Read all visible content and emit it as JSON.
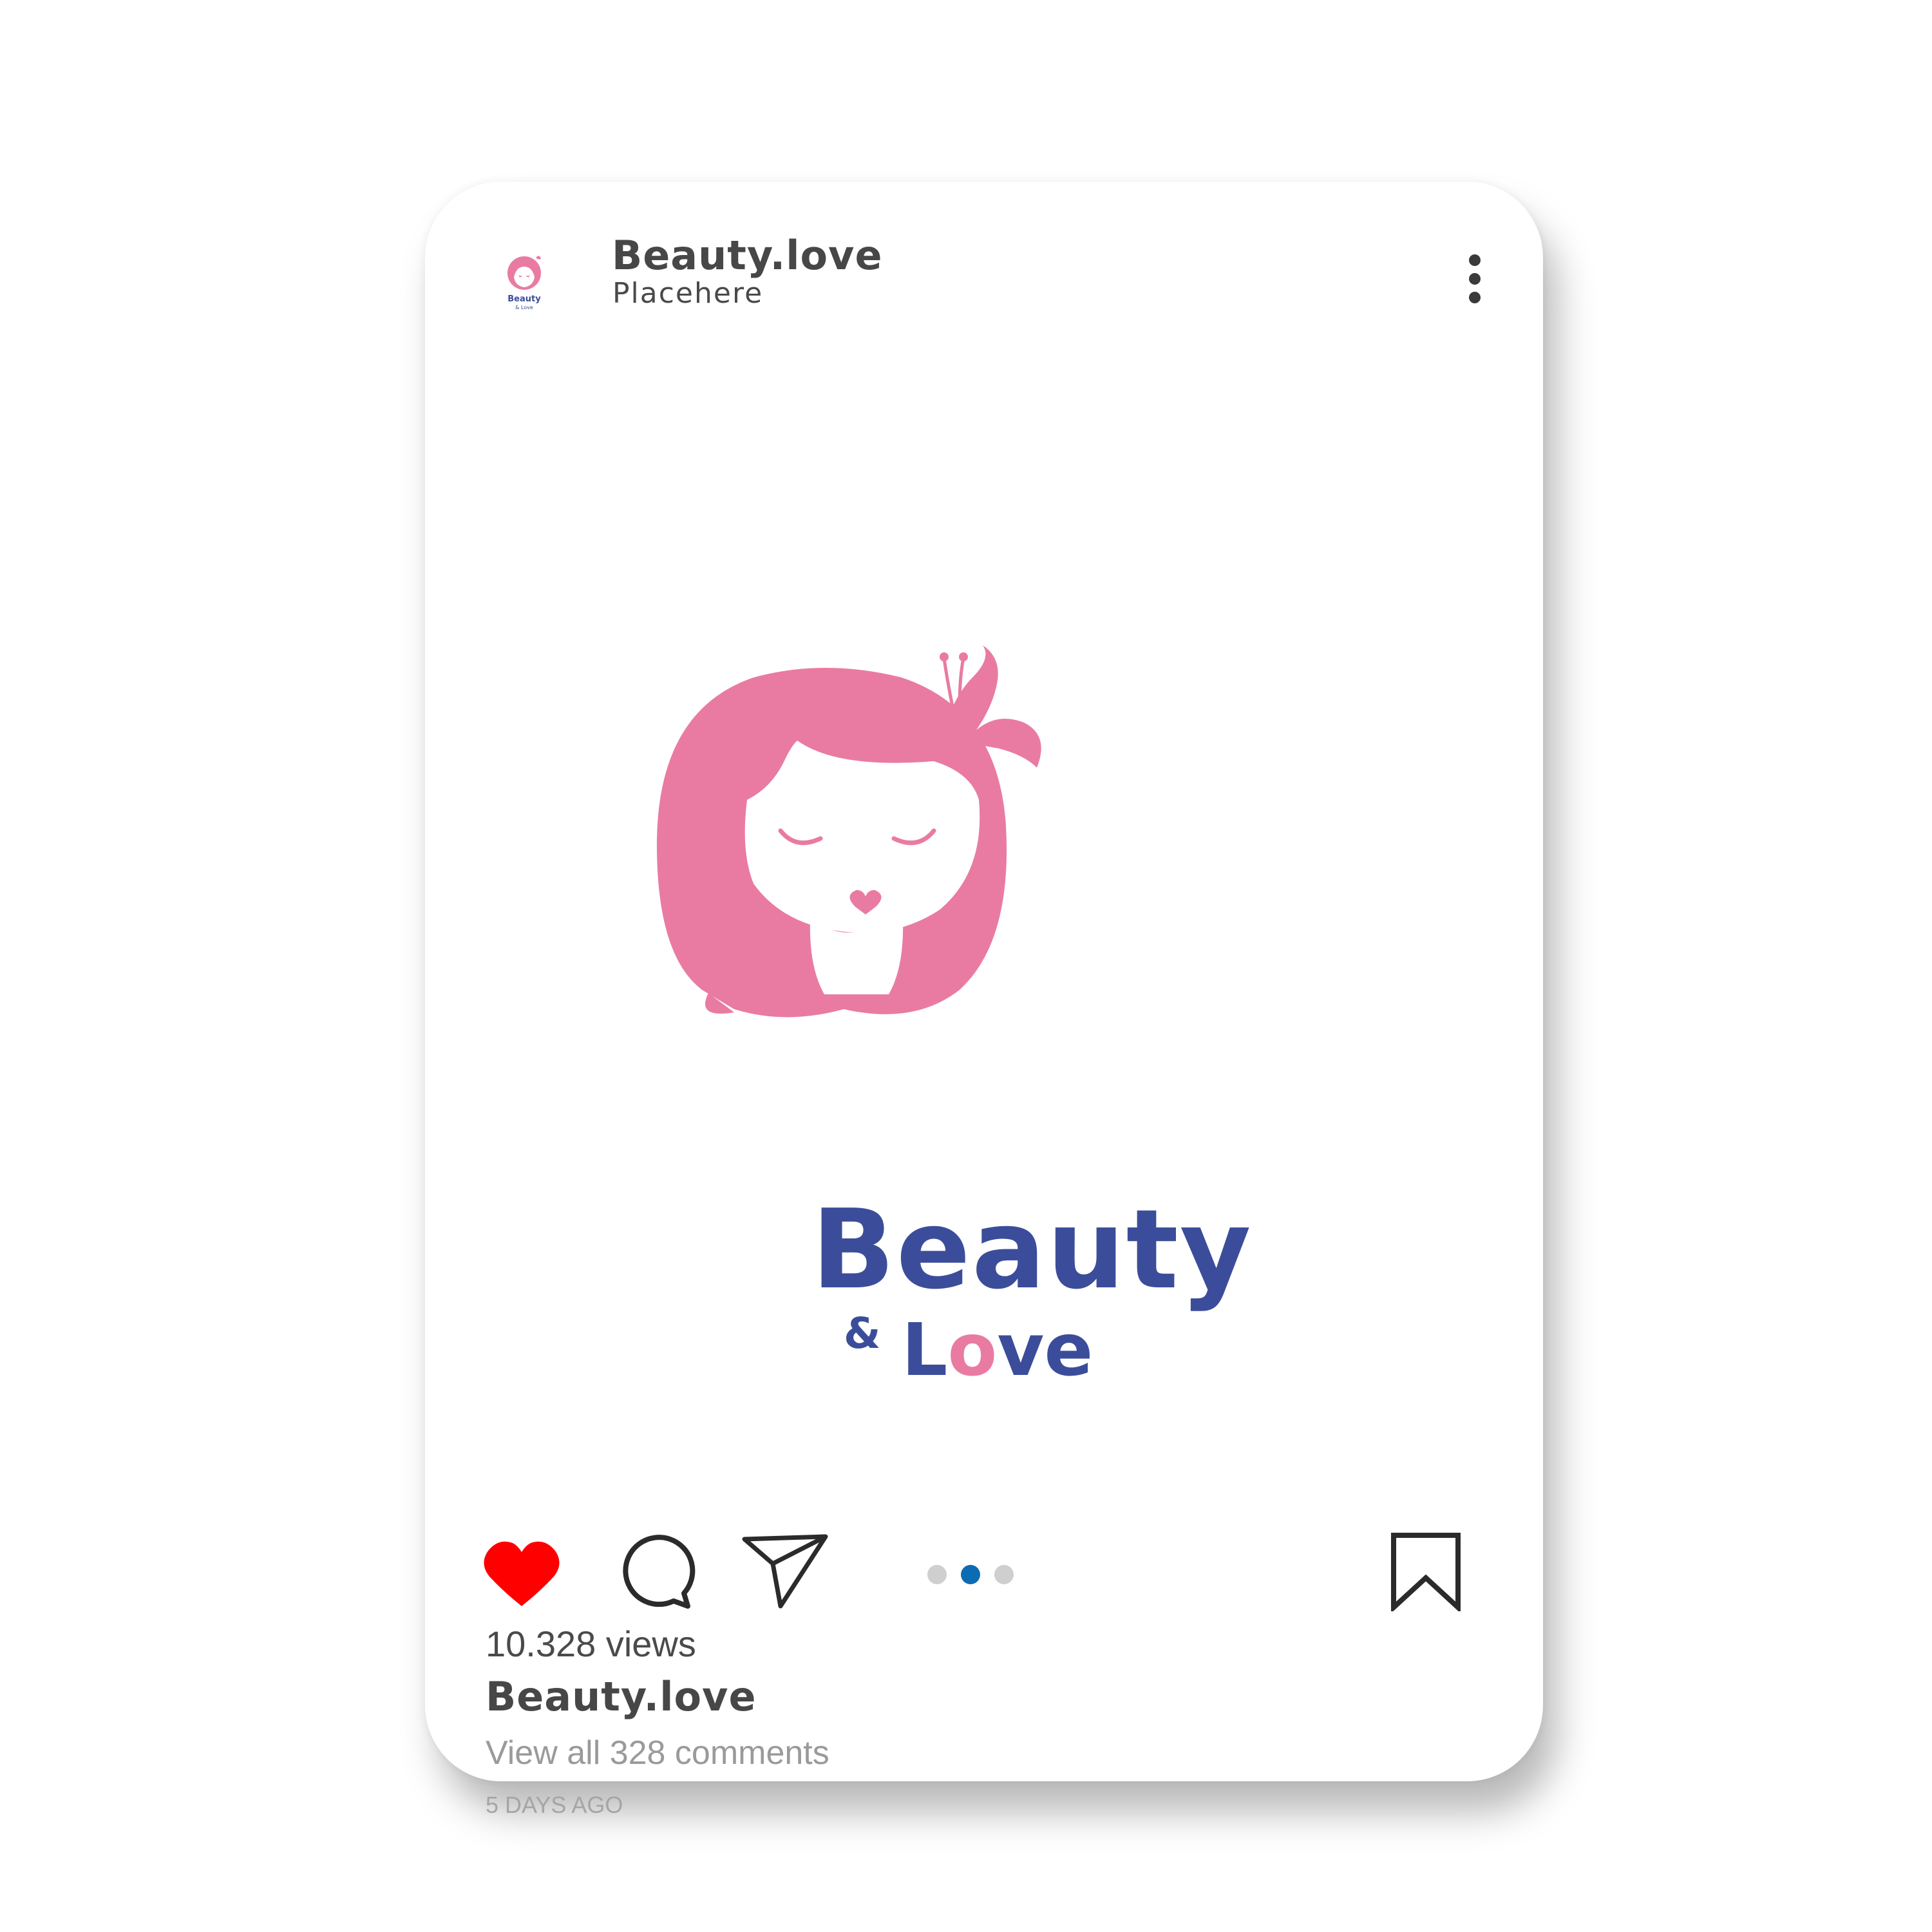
{
  "post": {
    "username": "Beauty.love",
    "location": "Placehere",
    "views": "10.328 views",
    "caption_username": "Beauty.love",
    "view_comments": "View all 328 comments",
    "timestamp": "5 DAYS AGO",
    "carousel": {
      "count": 3,
      "active_index": 1
    },
    "liked": true
  },
  "logo": {
    "word1": "Beauty",
    "ampersand": "&",
    "word2_l": "L",
    "word2_heart_o": "o",
    "word2_rest": "ve"
  },
  "icons": {
    "avatar": "brand-logo-avatar",
    "more": "more-vertical-icon",
    "like": "heart-icon",
    "comment": "comment-bubble-icon",
    "share": "paper-plane-icon",
    "bookmark": "bookmark-icon"
  },
  "colors": {
    "brand_pink": "#e97ba2",
    "brand_blue": "#3b4d9a",
    "like_red": "#ff0000",
    "carousel_active": "#0b6cb3",
    "carousel_inactive": "#cfcfcf"
  }
}
